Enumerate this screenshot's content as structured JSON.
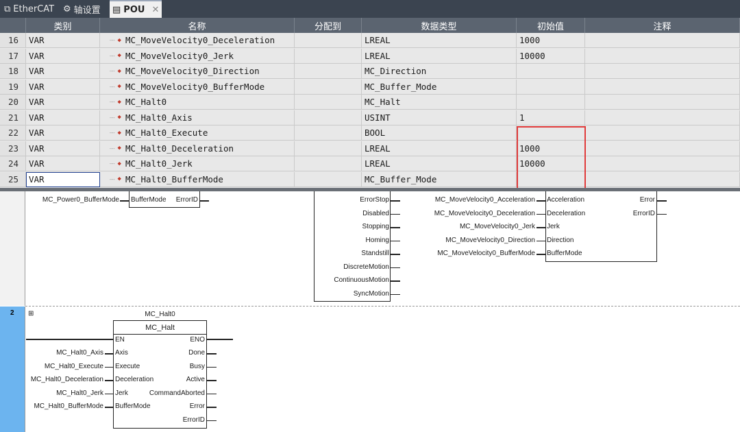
{
  "tabs": [
    {
      "label": "EtherCAT",
      "icon": "network-icon"
    },
    {
      "label": "轴设置",
      "icon": "gear-icon"
    },
    {
      "label": "POU",
      "icon": "pou-icon",
      "active": true
    }
  ],
  "columns": [
    "类别",
    "名称",
    "分配到",
    "数据类型",
    "初始值",
    "注释"
  ],
  "rows": [
    {
      "n": "16",
      "cat": "VAR",
      "name": "MC_MoveVelocity0_Deceleration",
      "type": "LREAL",
      "init": "1000"
    },
    {
      "n": "17",
      "cat": "VAR",
      "name": "MC_MoveVelocity0_Jerk",
      "type": "LREAL",
      "init": "10000"
    },
    {
      "n": "18",
      "cat": "VAR",
      "name": "MC_MoveVelocity0_Direction",
      "type": "MC_Direction",
      "init": ""
    },
    {
      "n": "19",
      "cat": "VAR",
      "name": "MC_MoveVelocity0_BufferMode",
      "type": "MC_Buffer_Mode",
      "init": ""
    },
    {
      "n": "20",
      "cat": "VAR",
      "name": "MC_Halt0",
      "type": "MC_Halt",
      "init": ""
    },
    {
      "n": "21",
      "cat": "VAR",
      "name": "MC_Halt0_Axis",
      "type": "USINT",
      "init": "1"
    },
    {
      "n": "22",
      "cat": "VAR",
      "name": "MC_Halt0_Execute",
      "type": "BOOL",
      "init": ""
    },
    {
      "n": "23",
      "cat": "VAR",
      "name": "MC_Halt0_Deceleration",
      "type": "LREAL",
      "init": "1000"
    },
    {
      "n": "24",
      "cat": "VAR",
      "name": "MC_Halt0_Jerk",
      "type": "LREAL",
      "init": "10000"
    },
    {
      "n": "25",
      "cat": "VAR",
      "name": "MC_Halt0_BufferMode",
      "type": "MC_Buffer_Mode",
      "init": ""
    }
  ],
  "ladder": {
    "rung1": {
      "power_var": "MC_Power0_BufferMode",
      "power_in": "BufferMode",
      "power_out": "ErrorID",
      "status_outputs": [
        "ErrorStop",
        "Disabled",
        "Stopping",
        "Homing",
        "Standstill",
        "DiscreteMotion",
        "ContinuousMotion",
        "SyncMotion"
      ],
      "mv_vars": [
        "MC_MoveVelocity0_Acceleration",
        "MC_MoveVelocity0_Deceleration",
        "MC_MoveVelocity0_Jerk",
        "MC_MoveVelocity0_Direction",
        "MC_MoveVelocity0_BufferMode"
      ],
      "mv_inputs": [
        "Acceleration",
        "Deceleration",
        "Jerk",
        "Direction",
        "BufferMode"
      ],
      "mv_outputs": [
        "Error",
        "ErrorID"
      ]
    },
    "rung2": {
      "number": "2",
      "instance": "MC_Halt0",
      "fb_type": "MC_Halt",
      "en": "EN",
      "eno": "ENO",
      "inputs": [
        "Axis",
        "Execute",
        "Deceleration",
        "Jerk",
        "BufferMode"
      ],
      "input_vars": [
        "MC_Halt0_Axis",
        "MC_Halt0_Execute",
        "MC_Halt0_Deceleration",
        "MC_Halt0_Jerk",
        "MC_Halt0_BufferMode"
      ],
      "outputs": [
        "Done",
        "Busy",
        "Active",
        "CommandAborted",
        "Error",
        "ErrorID"
      ],
      "expand_symbol": "⊞"
    }
  }
}
